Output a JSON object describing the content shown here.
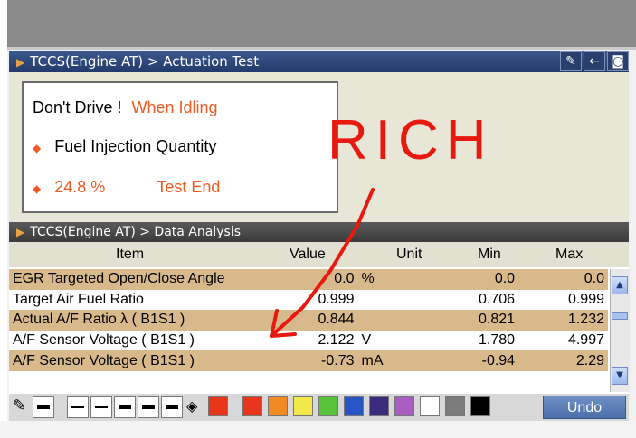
{
  "actuation_title": "TCCS(Engine AT) > Actuation Test",
  "analysis_title": "TCCS(Engine AT) > Data Analysis",
  "info": {
    "warning": "Don't Drive !",
    "condition": "When Idling",
    "item": "Fuel Injection Quantity",
    "value": "24.8 %",
    "status": "Test End"
  },
  "annotation": "RICH",
  "columns": [
    "Item",
    "Value",
    "Unit",
    "Min",
    "Max"
  ],
  "rows": [
    {
      "item": "EGR Targeted Open/Close Angle",
      "value": "0.0",
      "unit": "%",
      "min": "0.0",
      "max": "0.0"
    },
    {
      "item": "Target Air Fuel Ratio",
      "value": "0.999",
      "unit": "",
      "min": "0.706",
      "max": "0.999"
    },
    {
      "item": "Actual A/F Ratio λ ( B1S1 )",
      "value": "0.844",
      "unit": "",
      "min": "0.821",
      "max": "1.232"
    },
    {
      "item": "A/F Sensor Voltage ( B1S1 )",
      "value": "2.122",
      "unit": "V",
      "min": "1.780",
      "max": "4.997"
    },
    {
      "item": "A/F Sensor Voltage ( B1S1 )",
      "value": "-0.73",
      "unit": "mA",
      "min": "-0.94",
      "max": "2.29"
    }
  ],
  "palette": [
    "#e8361d",
    "#f08a22",
    "#f2e84a",
    "#58c23a",
    "#2a55c5",
    "#3b2b7d",
    "#a85fc1",
    "#ffffff",
    "#7b7b7b",
    "#000000"
  ],
  "undo_label": "Undo",
  "icons": {
    "pen": "pen-icon",
    "back": "back-arrow-icon",
    "camera": "camera-icon",
    "fill": "paint-bucket-icon"
  }
}
